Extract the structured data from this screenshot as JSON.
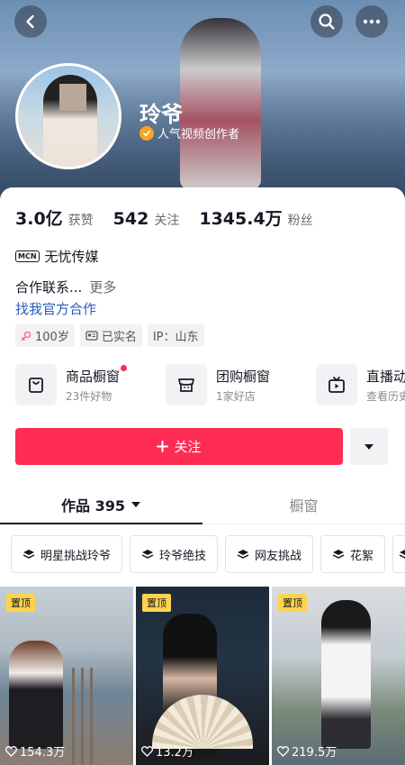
{
  "profile": {
    "name": "玲爷",
    "badge": "人气视频创作者"
  },
  "stats": [
    {
      "value": "3.0亿",
      "label": "获赞"
    },
    {
      "value": "542",
      "label": "关注"
    },
    {
      "value": "1345.4万",
      "label": "粉丝"
    }
  ],
  "org": {
    "mcn": "MCN",
    "name": "无忧传媒"
  },
  "bio": {
    "text": "合作联系...",
    "more": "更多"
  },
  "official_link": "找我官方合作",
  "tags": [
    {
      "icon": "female-icon",
      "label": "100岁"
    },
    {
      "icon": "id-card-icon",
      "label": "已实名"
    },
    {
      "icon": "",
      "label": "IP：山东"
    }
  ],
  "shops": [
    {
      "icon": "shopping-bag-icon",
      "title": "商品橱窗",
      "sub": "23件好物",
      "dot": true
    },
    {
      "icon": "group-buy-icon",
      "title": "团购橱窗",
      "sub": "1家好店",
      "dot": false
    },
    {
      "icon": "tv-icon",
      "title": "直播动态",
      "sub": "查看历史",
      "dot": false
    }
  ],
  "follow_button": {
    "label": "关注"
  },
  "tabs": [
    {
      "label": "作品 395",
      "active": true
    },
    {
      "label": "橱窗",
      "active": false
    }
  ],
  "collections": [
    "明星挑战玲爷",
    "玲爷绝技",
    "网友挑战",
    "花絮"
  ],
  "videos": [
    {
      "pinned": "置顶",
      "likes": "154.3万"
    },
    {
      "pinned": "置顶",
      "likes": "13.2万"
    },
    {
      "pinned": "置顶",
      "likes": "219.5万"
    }
  ],
  "colors": {
    "accent": "#fe2c55",
    "link": "#2b5bbd",
    "pin": "#fcd34d"
  }
}
